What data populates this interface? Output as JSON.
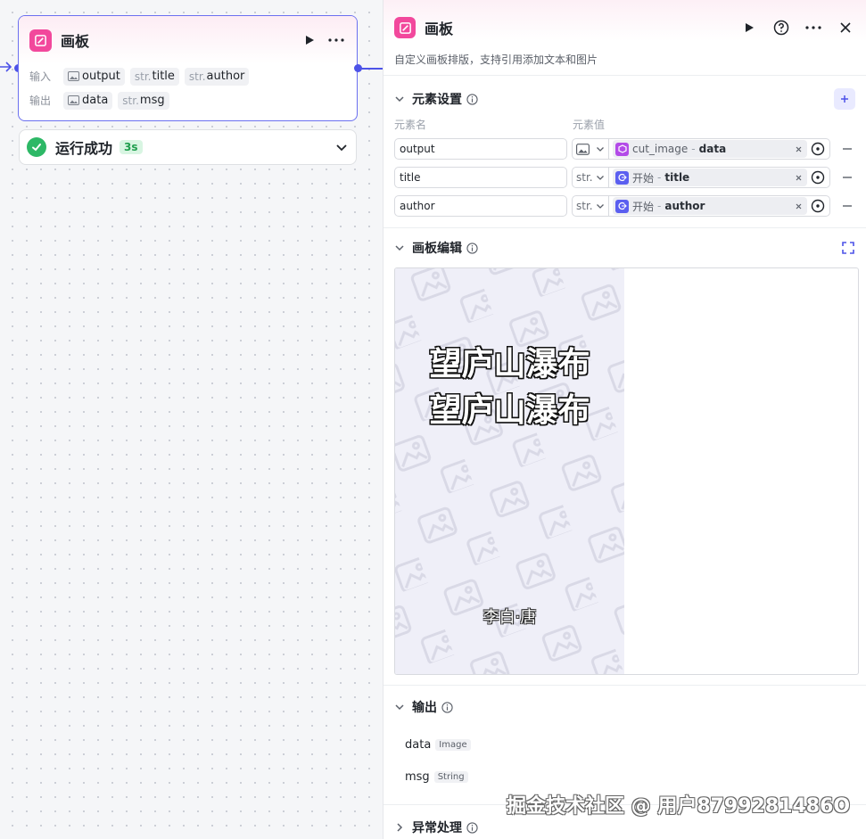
{
  "node": {
    "title": "画板",
    "input_label": "输入",
    "output_label": "输出",
    "inputs": [
      {
        "type": "",
        "name": "output"
      },
      {
        "type": "str.",
        "name": "title"
      },
      {
        "type": "str.",
        "name": "author"
      }
    ],
    "outputs": [
      {
        "type": "",
        "name": "data"
      },
      {
        "type": "str.",
        "name": "msg"
      }
    ]
  },
  "status": {
    "text": "运行成功",
    "duration": "3s"
  },
  "panel": {
    "title": "画板",
    "description": "自定义画板排版，支持引用添加文本和图片",
    "elements_section": {
      "title": "元素设置",
      "col_name": "元素名",
      "col_value": "元素值",
      "rows": [
        {
          "name": "output",
          "type": "",
          "source": "cut_image",
          "sep": "-",
          "field": "data",
          "icon_color": "#b34be8"
        },
        {
          "name": "title",
          "type": "str.",
          "source": "开始",
          "sep": "-",
          "field": "title",
          "icon_color": "#5b5ff0"
        },
        {
          "name": "author",
          "type": "str.",
          "source": "开始",
          "sep": "-",
          "field": "author",
          "icon_color": "#5b5ff0"
        }
      ]
    },
    "canvas_section": {
      "title": "画板编辑",
      "poster_title_line1": "望庐山瀑布",
      "poster_title_line2": "望庐山瀑布",
      "poster_author": "李白·唐"
    },
    "output_section": {
      "title": "输出",
      "items": [
        {
          "name": "data",
          "type": "Image"
        },
        {
          "name": "msg",
          "type": "String"
        }
      ]
    },
    "error_section": {
      "title": "异常处理"
    }
  },
  "watermark": "掘金技术社区 @ 用户8799281486O",
  "colors": {
    "accent": "#4d53e8",
    "brand_pink": "#f2489c",
    "success": "#2db866"
  }
}
